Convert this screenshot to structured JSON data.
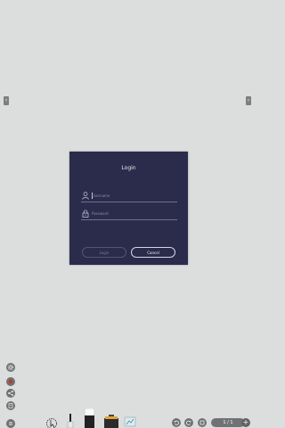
{
  "nav": {
    "left_arrow": "‹",
    "right_arrow": "›"
  },
  "login": {
    "title": "Login",
    "username_placeholder": "Username",
    "password_placeholder": "Password",
    "login_label": "Login",
    "cancel_label": "Cancel"
  },
  "left_toolbar": {
    "items": [
      {
        "icon": "settings-icon"
      },
      {
        "icon": "record-icon"
      },
      {
        "icon": "share-icon"
      },
      {
        "icon": "file-icon"
      },
      {
        "icon": "menu-icon"
      }
    ]
  },
  "bottom_toolbar": {
    "tools": [
      "select-tool-icon",
      "pen-tool-icon",
      "eraser-tool-icon",
      "toolbox-icon",
      "whiteboard-icon"
    ],
    "actions": [
      "undo-icon",
      "redo-icon",
      "page-icon"
    ],
    "page_indicator": "1 / 1",
    "add_page": "+"
  },
  "colors": {
    "background": "#dcdedd",
    "dialog": "#2b2c4b",
    "icon_gray": "#6f7274",
    "record_red": "#c0392b"
  }
}
